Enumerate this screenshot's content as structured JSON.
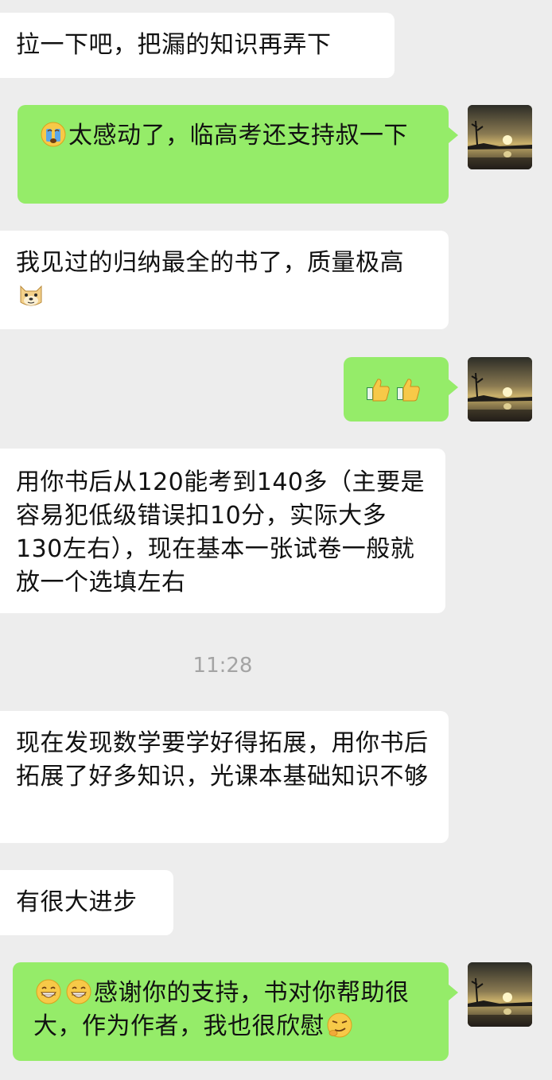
{
  "messages": {
    "m1": "拉一下吧，把漏的知识再弄下",
    "m2": "太感动了，临高考还支持叔一下",
    "m3": "我见过的归纳最全的书了，质量极高",
    "m4": "",
    "m5": "用你书后从120能考到140多（主要是容易犯低级错误扣10分，实际大多130左右），现在基本一张试卷一般就放一个选填左右",
    "m6": "现在发现数学要学好得拓展，用你书后拓展了好多知识，光课本基础知识不够",
    "m7": "有很大进步",
    "m8": "感谢你的支持，书对你帮助很大，作为作者，我也很欣慰"
  },
  "timestamp": "11:28",
  "icons": {
    "m2_lead": "crying-face-icon",
    "m3_tail": "doge-icon",
    "m4": [
      "thumbs-up-icon",
      "thumbs-up-icon"
    ],
    "m8_lead": [
      "grinning-face-icon",
      "grinning-face-icon"
    ],
    "m8_tail": "smirk-face-icon"
  },
  "colors": {
    "background": "#ededed",
    "incoming_bubble": "#ffffff",
    "outgoing_bubble": "#95ec69",
    "timestamp": "#a4a4a4"
  }
}
